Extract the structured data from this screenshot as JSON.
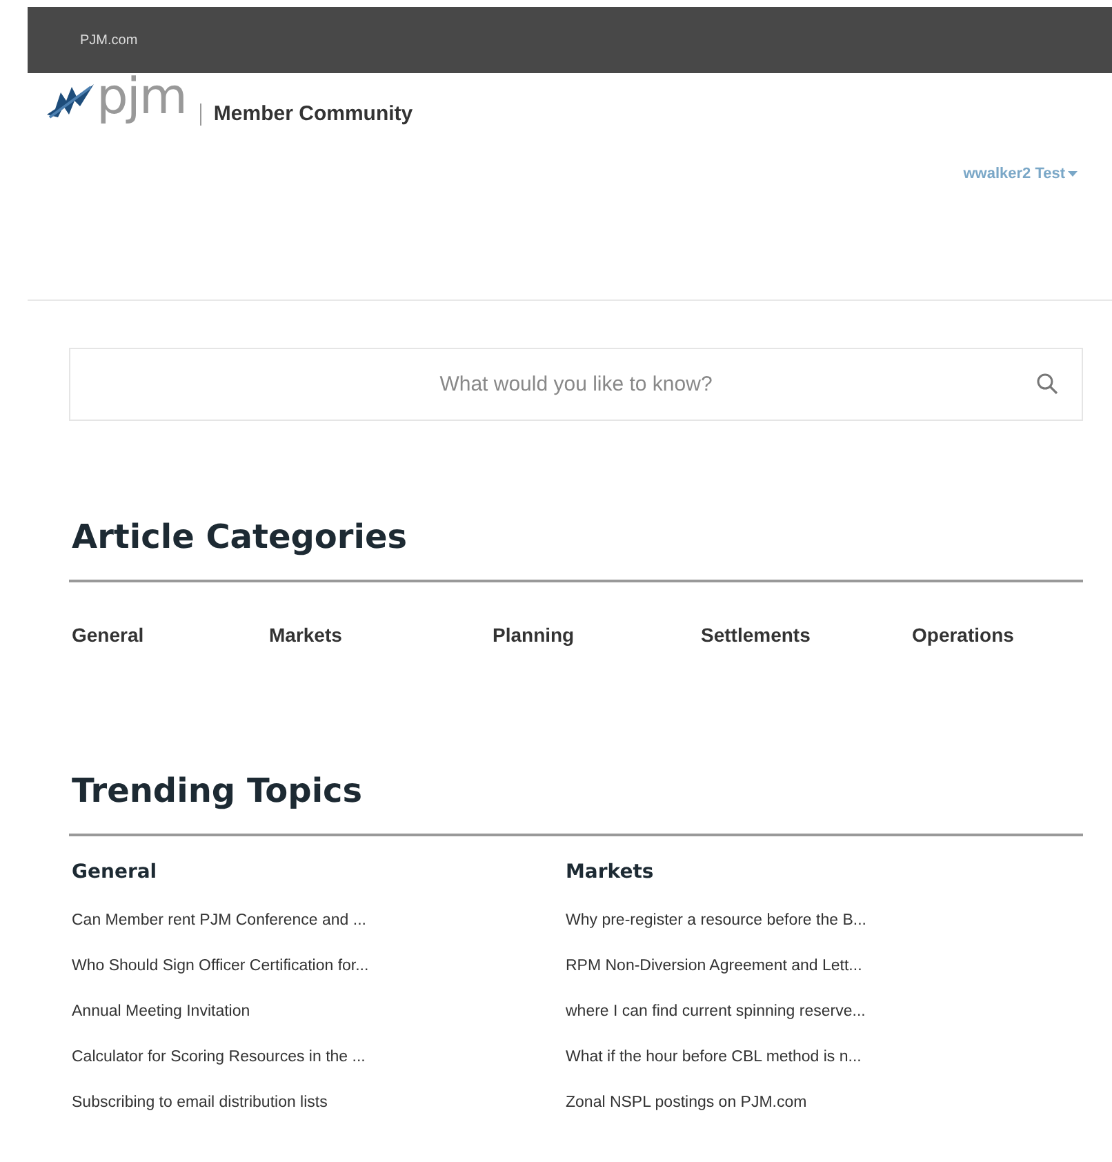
{
  "top_bar": {
    "link": "PJM.com"
  },
  "header": {
    "logo_text": "pjm",
    "site_title": "Member Community",
    "user_menu": "wwalker2 Test"
  },
  "search": {
    "placeholder": "What would you like to know?"
  },
  "article_categories": {
    "title": "Article Categories",
    "items": [
      "General",
      "Markets",
      "Planning",
      "Settlements",
      "Operations"
    ]
  },
  "trending_topics": {
    "title": "Trending Topics",
    "columns": [
      {
        "heading": "General",
        "items": [
          "Can Member rent PJM Conference and ...",
          "Who Should Sign Officer Certification for...",
          "Annual Meeting Invitation",
          "Calculator for Scoring Resources in the ...",
          "Subscribing to email distribution lists"
        ]
      },
      {
        "heading": "Markets",
        "items": [
          "Why pre-register a resource before the B...",
          "RPM Non-Diversion Agreement and Lett...",
          "where I can find current spinning reserve...",
          "What if the hour before CBL method is n...",
          "Zonal NSPL postings on PJM.com"
        ]
      }
    ]
  }
}
